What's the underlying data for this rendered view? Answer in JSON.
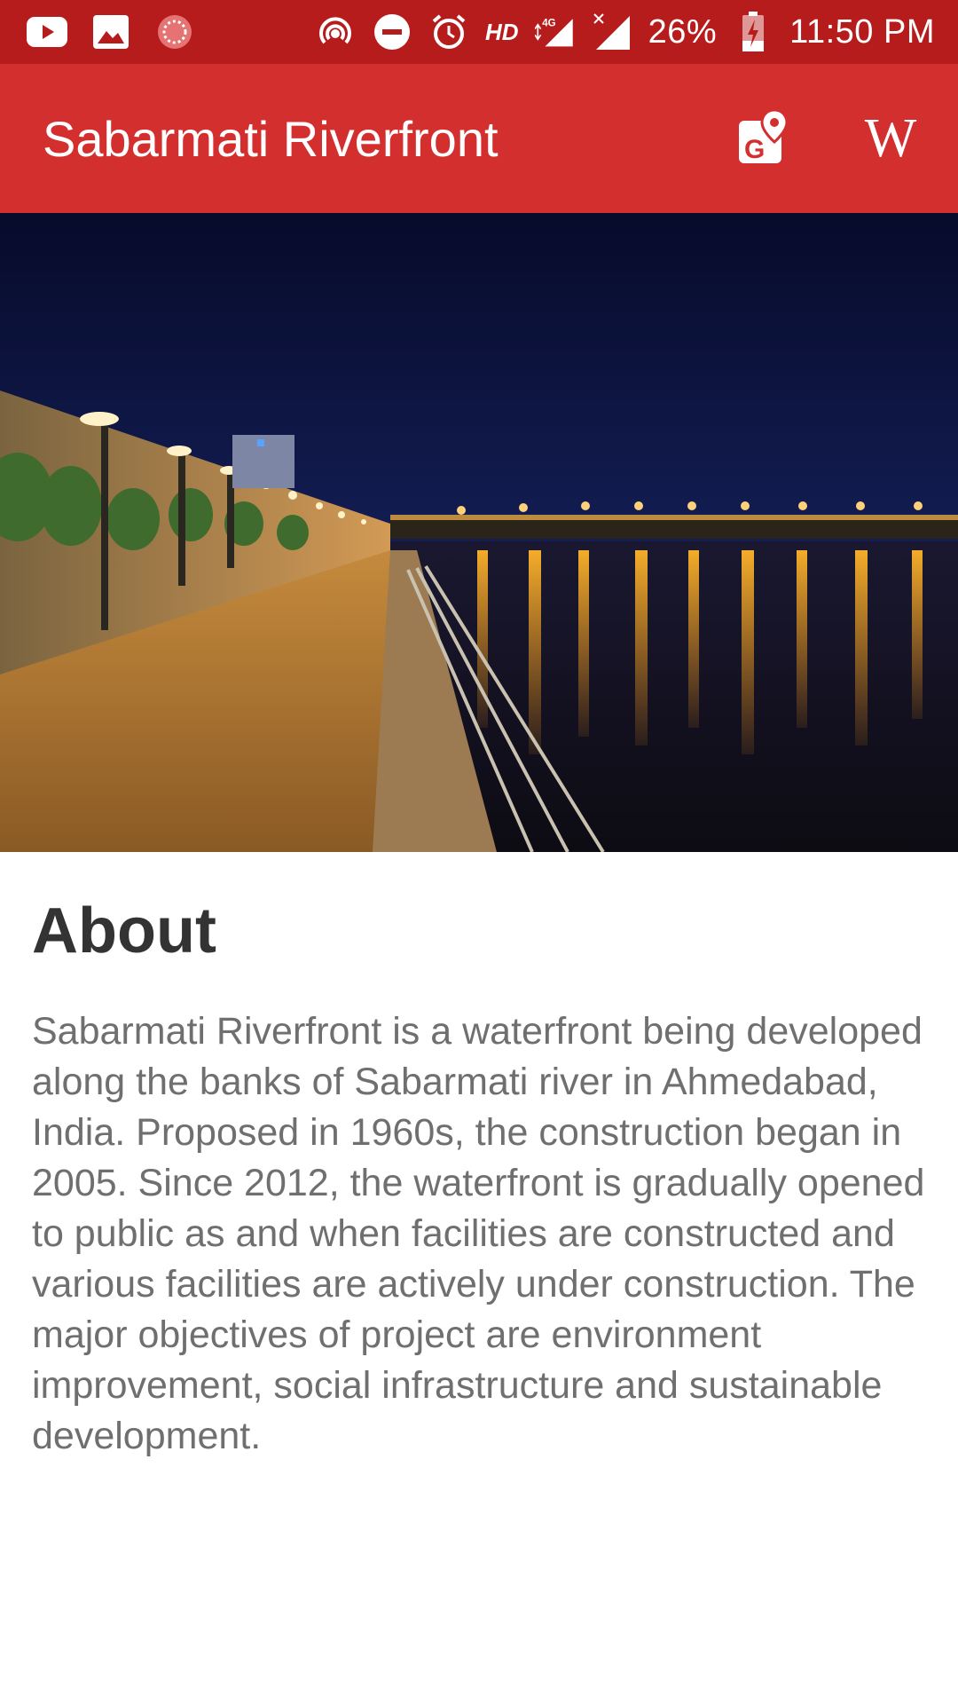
{
  "status_bar": {
    "battery": "26%",
    "time": "11:50 PM",
    "network_label": "HD",
    "network_type": "4G",
    "icons": [
      "youtube-icon",
      "gallery-icon",
      "app-icon",
      "hotspot-icon",
      "do-not-disturb-icon",
      "alarm-icon",
      "signal-icon",
      "no-signal-icon",
      "battery-charging-icon"
    ]
  },
  "app_bar": {
    "title": "Sabarmati Riverfront",
    "actions": [
      "map-location-icon",
      "wikipedia-icon"
    ],
    "wiki_glyph": "W",
    "colors": {
      "status_bar": "#b71c1c",
      "app_bar": "#d32f2f"
    }
  },
  "hero": {
    "subject": "riverfront-night-photo"
  },
  "about": {
    "heading": "About",
    "body": "Sabarmati Riverfront is a waterfront being developed along the banks of Sabarmati river in Ahmedabad, India. Proposed in 1960s, the construction began in 2005. Since 2012, the waterfront is gradually opened to public as and when facilities are constructed and various facilities are actively under construction. The major objectives of project are environment improvement, social infrastructure and sustainable development."
  }
}
